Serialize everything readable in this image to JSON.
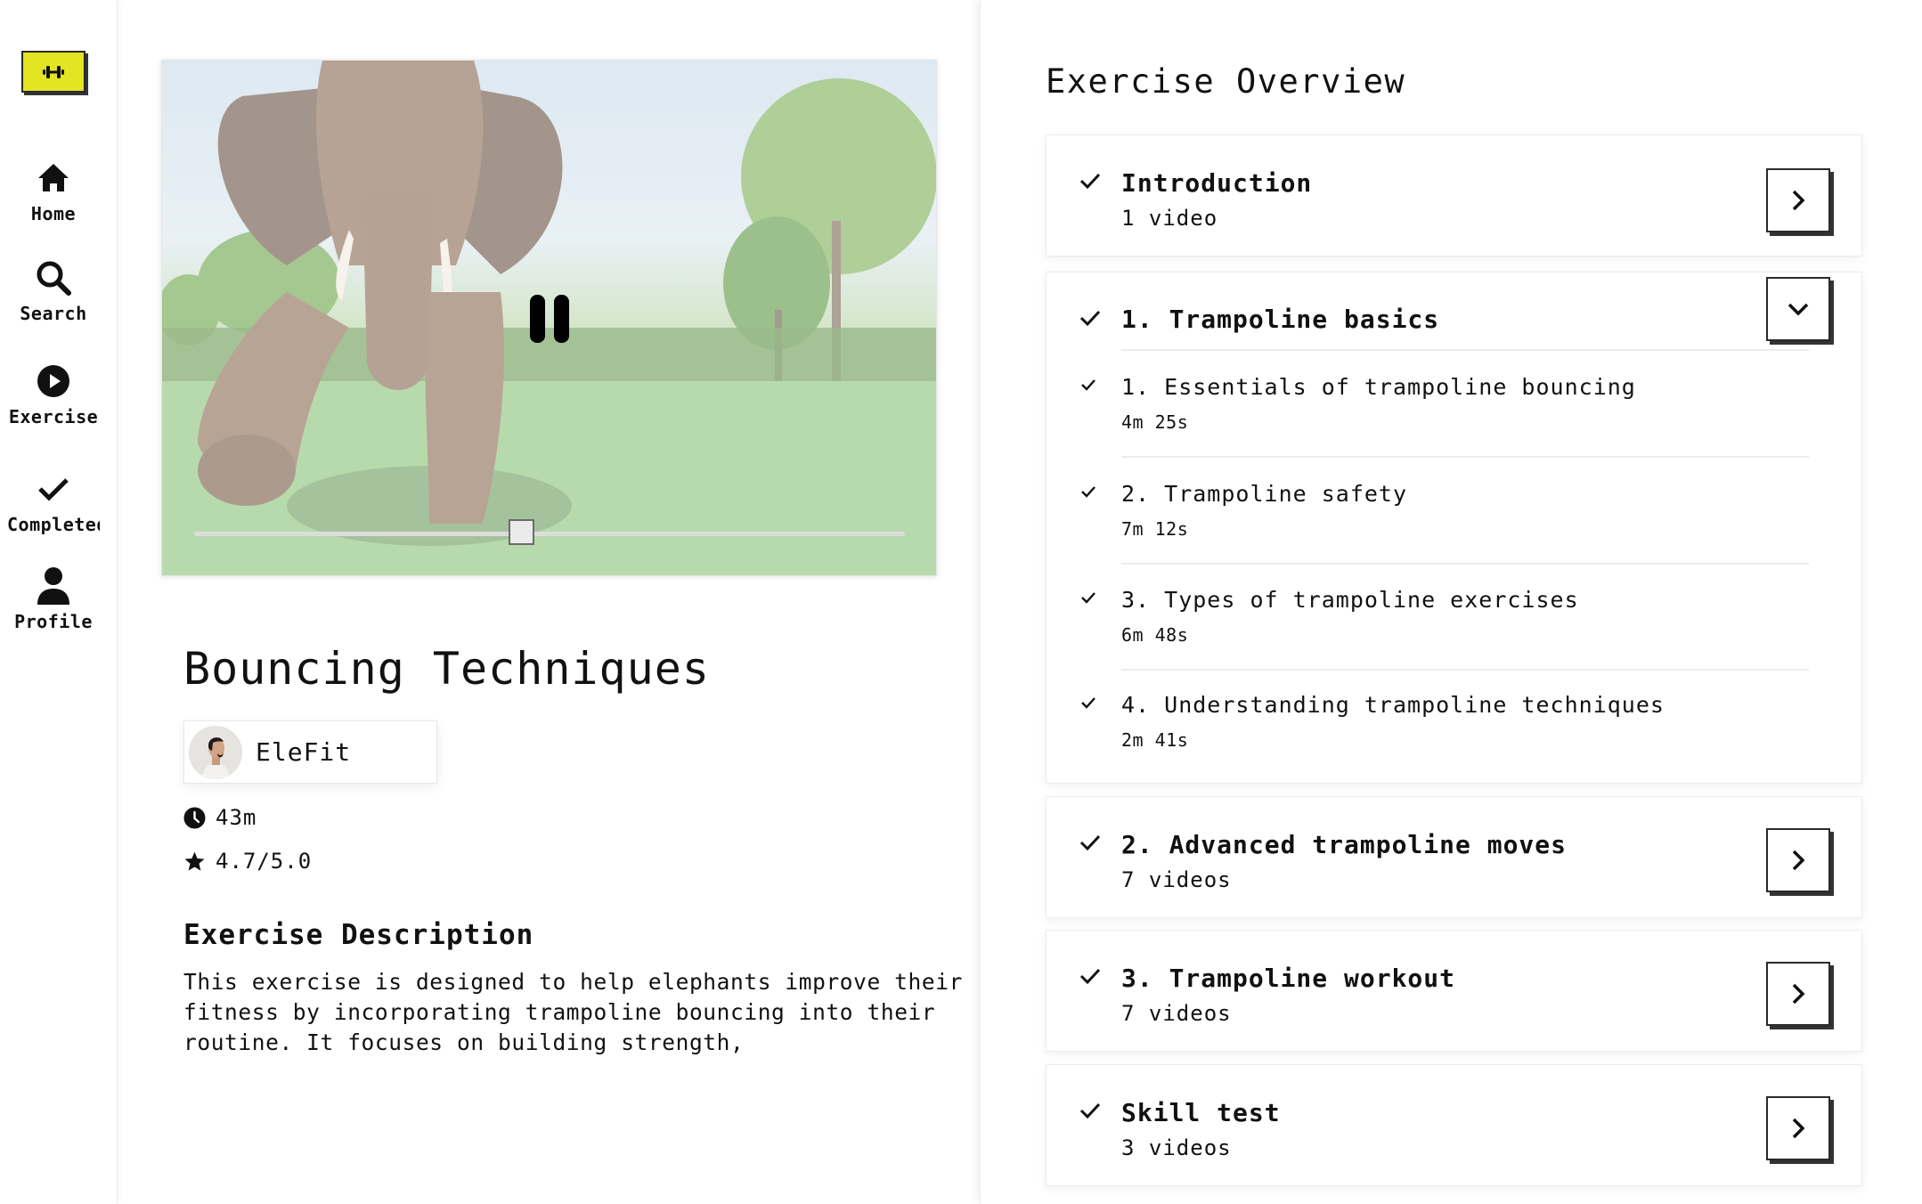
{
  "sidebar": {
    "logo_icon": "dumbbell-icon",
    "logo_color": "#e3e422",
    "items": [
      {
        "label": "Home",
        "icon": "home-icon"
      },
      {
        "label": "Search",
        "icon": "search-icon"
      },
      {
        "label": "Exercise",
        "icon": "play-circle-icon"
      },
      {
        "label": "Completed",
        "icon": "check-icon"
      },
      {
        "label": "Profile",
        "icon": "person-icon"
      }
    ]
  },
  "video": {
    "state": "playing",
    "control_icon": "pause-icon",
    "progress": 0.46
  },
  "exercise": {
    "title": "Bouncing Techniques",
    "author": "EleFit",
    "duration": "43m",
    "rating": "4.7/5.0",
    "description_heading": "Exercise Description",
    "description": "This exercise is designed to help elephants improve their fitness by incorporating trampoline bouncing into their routine. It focuses on building strength,"
  },
  "overview": {
    "title": "Exercise Overview",
    "sections": [
      {
        "title": "Introduction",
        "subtitle": "1 video",
        "completed": true,
        "expanded": false
      },
      {
        "title": "1. Trampoline basics",
        "completed": true,
        "expanded": true,
        "lessons": [
          {
            "title": "1. Essentials of trampoline bouncing",
            "duration": "4m 25s",
            "completed": true
          },
          {
            "title": "2. Trampoline safety",
            "duration": "7m 12s",
            "completed": true
          },
          {
            "title": "3. Types of trampoline exercises",
            "duration": "6m 48s",
            "completed": true
          },
          {
            "title": "4. Understanding trampoline techniques",
            "duration": "2m 41s",
            "completed": true
          }
        ]
      },
      {
        "title": "2. Advanced trampoline moves",
        "subtitle": "7 videos",
        "completed": true,
        "expanded": false
      },
      {
        "title": "3. Trampoline workout",
        "subtitle": "7 videos",
        "completed": true,
        "expanded": false
      },
      {
        "title": "Skill test",
        "subtitle": "3 videos",
        "completed": true,
        "expanded": false
      }
    ]
  }
}
